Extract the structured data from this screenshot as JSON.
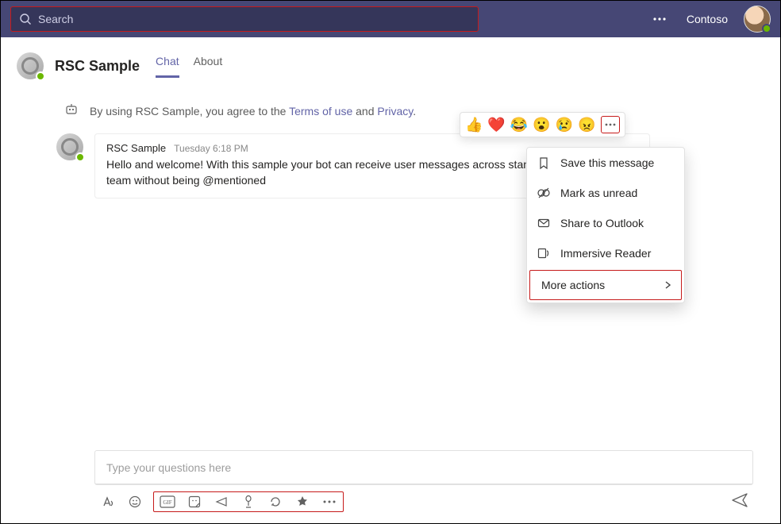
{
  "titlebar": {
    "search_placeholder": "Search",
    "org_name": "Contoso"
  },
  "chat": {
    "title": "RSC Sample",
    "tabs": [
      {
        "label": "Chat",
        "active": true
      },
      {
        "label": "About",
        "active": false
      }
    ]
  },
  "notice": {
    "prefix": "By using RSC Sample, you agree to the ",
    "terms_label": "Terms of use",
    "and_word": " and ",
    "privacy_label": "Privacy",
    "suffix": "."
  },
  "message": {
    "sender": "RSC Sample",
    "timestamp": "Tuesday 6:18 PM",
    "body": "Hello and welcome! With this sample your bot can receive user messages across standard channels in a team without being @mentioned"
  },
  "reactions": {
    "items": [
      "👍",
      "❤️",
      "😂",
      "😮",
      "😢",
      "😠"
    ]
  },
  "context_menu": {
    "items": [
      {
        "label": "Save this message",
        "icon": "bookmark-icon"
      },
      {
        "label": "Mark as unread",
        "icon": "unread-icon"
      },
      {
        "label": "Share to Outlook",
        "icon": "mail-icon"
      },
      {
        "label": "Immersive Reader",
        "icon": "reader-icon"
      }
    ],
    "more_label": "More actions"
  },
  "compose": {
    "placeholder": "Type your questions here"
  }
}
